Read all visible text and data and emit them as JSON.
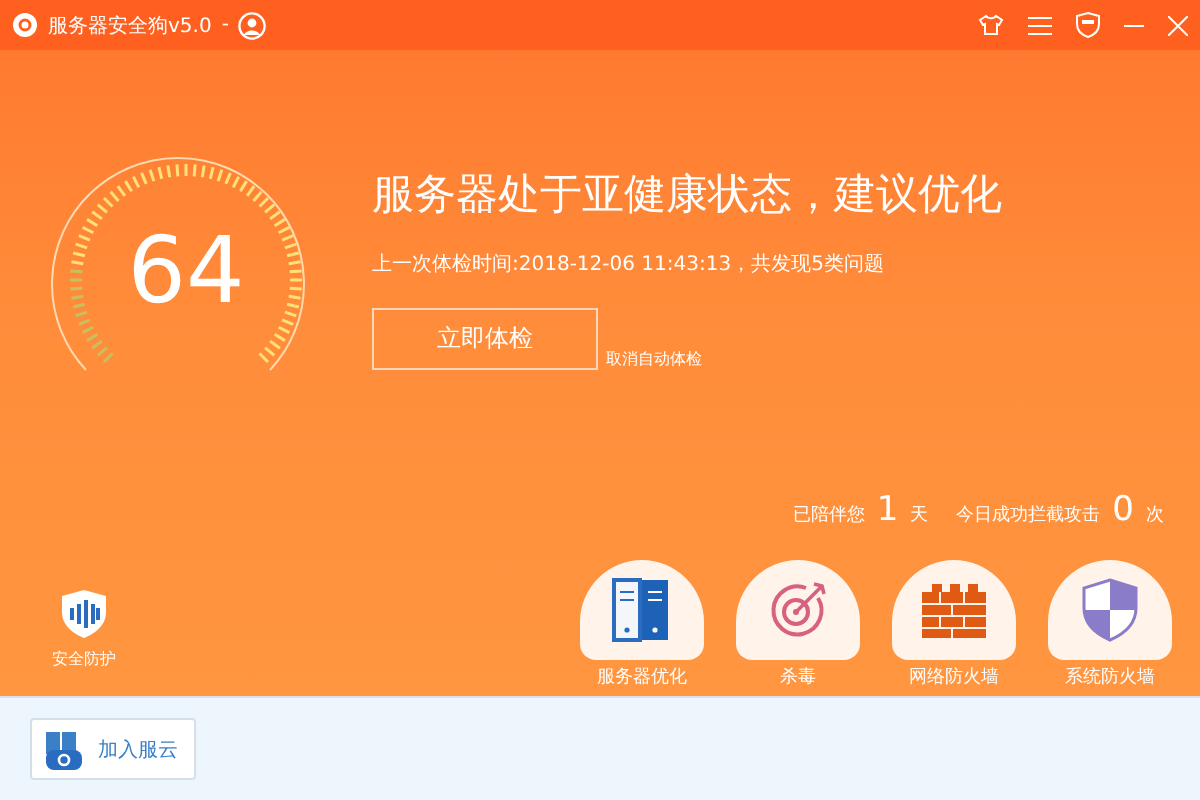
{
  "window": {
    "title": "服务器安全狗v5.0",
    "title_suffix": "-"
  },
  "status": {
    "score": "64",
    "headline": "服务器处于亚健康状态，建议优化",
    "last_check": "上一次体检时间:2018-12-06 11:43:13，共发现5类问题",
    "check_button": "立即体检",
    "cancel_auto": "取消自动体检"
  },
  "stats": [
    {
      "label": "已陪伴您",
      "value": "1",
      "unit": "天"
    },
    {
      "label": "今日成功拦截攻击",
      "value": "0",
      "unit": "次"
    }
  ],
  "protection": {
    "label": "安全防护"
  },
  "features": [
    {
      "kind": "server",
      "label": "服务器优化"
    },
    {
      "kind": "antivirus",
      "label": "杀毒"
    },
    {
      "kind": "firewall",
      "label": "网络防火墙"
    },
    {
      "kind": "shield",
      "label": "系统防火墙"
    }
  ],
  "footer": {
    "join_button": "加入服云"
  }
}
